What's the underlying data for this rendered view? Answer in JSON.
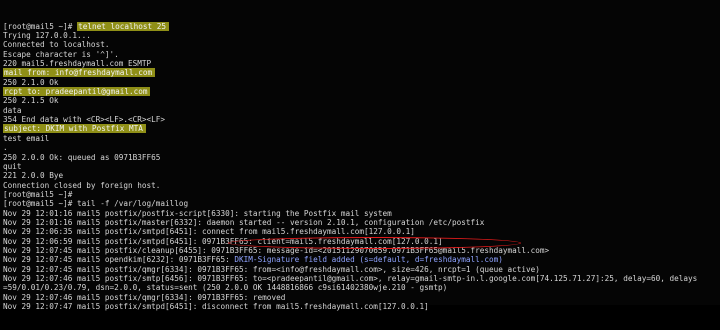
{
  "terminal": {
    "lines": [
      {
        "prompt": "[root@mail5 ~]# ",
        "highlight": "telnet localhost 25"
      },
      {
        "text": "Trying 127.0.0.1..."
      },
      {
        "text": "Connected to localhost."
      },
      {
        "text": "Escape character is '^]'."
      },
      {
        "text": "220 mail5.freshdaymall.com ESMTP"
      },
      {
        "highlight": "mail from: info@freshdaymall.com"
      },
      {
        "text": "250 2.1.0 Ok"
      },
      {
        "highlight": "rcpt to: pradeepantil@gmail.com"
      },
      {
        "text": "250 2.1.5 Ok"
      },
      {
        "text": "data"
      },
      {
        "text": "354 End data with <CR><LF>.<CR><LF>"
      },
      {
        "highlight": "subject: DKIM with Postfix MTA"
      },
      {
        "text": "test email"
      },
      {
        "text": "."
      },
      {
        "text": "250 2.0.0 Ok: queued as 0971B3FF65"
      },
      {
        "text": "quit"
      },
      {
        "text": "221 2.0.0 Bye"
      },
      {
        "text": "Connection closed by foreign host."
      },
      {
        "text": "[root@mail5 ~]#"
      },
      {
        "text": "[root@mail5 ~]# tail -f /var/log/maillog"
      },
      {
        "text": "Nov 29 12:01:16 mail5 postfix/postfix-script[6330]: starting the Postfix mail system"
      },
      {
        "text": "Nov 29 12:01:16 mail5 postfix/master[6332]: daemon started -- version 2.10.1, configuration /etc/postfix"
      },
      {
        "text": "Nov 29 12:06:35 mail5 postfix/smtpd[6451]: connect from mail5.freshdaymall.com[127.0.0.1]"
      },
      {
        "text": "Nov 29 12:06:59 mail5 postfix/smtpd[6451]: 0971B3FF65: client=mail5.freshdaymall.com[127.0.0.1]"
      },
      {
        "text": "Nov 29 12:07:45 mail5 postfix/cleanup[6455]: 0971B3FF65: message-id=<20151129070659.0971B3FF65@mail5.freshdaymall.com>"
      },
      {
        "text": "Nov 29 12:07:45 mail5 opendkim[6232]: 0971B3FF65: ",
        "blue": "DKIM-Signature field added (s=default, d=freshdaymall.com)"
      },
      {
        "text": "Nov 29 12:07:45 mail5 postfix/qmgr[6334]: 0971B3FF65: from=<info@freshdaymall.com>, size=426, nrcpt=1 (queue active)"
      },
      {
        "text": "Nov 29 12:07:46 mail5 postfix/smtp[6456]: 0971B3FF65: to=<pradeepantil@gmail.com>, relay=gmail-smtp-in.l.google.com[74.125.71.27]:25, delay=60, delays"
      },
      {
        "text": "=59/0.01/0.23/0.79, dsn=2.0.0, status=sent (250 2.0.0 OK 1448816866 c9si61402380wje.210 - gsmtp)"
      },
      {
        "text": "Nov 29 12:07:46 mail5 postfix/qmgr[6334]: 0971B3FF65: removed"
      },
      {
        "text": "Nov 29 12:07:47 mail5 postfix/smtpd[6451]: disconnect from mail5.freshdaymall.com[127.0.0.1]"
      }
    ]
  },
  "colors": {
    "background": "#050505",
    "text": "#d6d6d6",
    "highlight": "#8f8f17",
    "annotation_oval": "#e21b1b"
  }
}
